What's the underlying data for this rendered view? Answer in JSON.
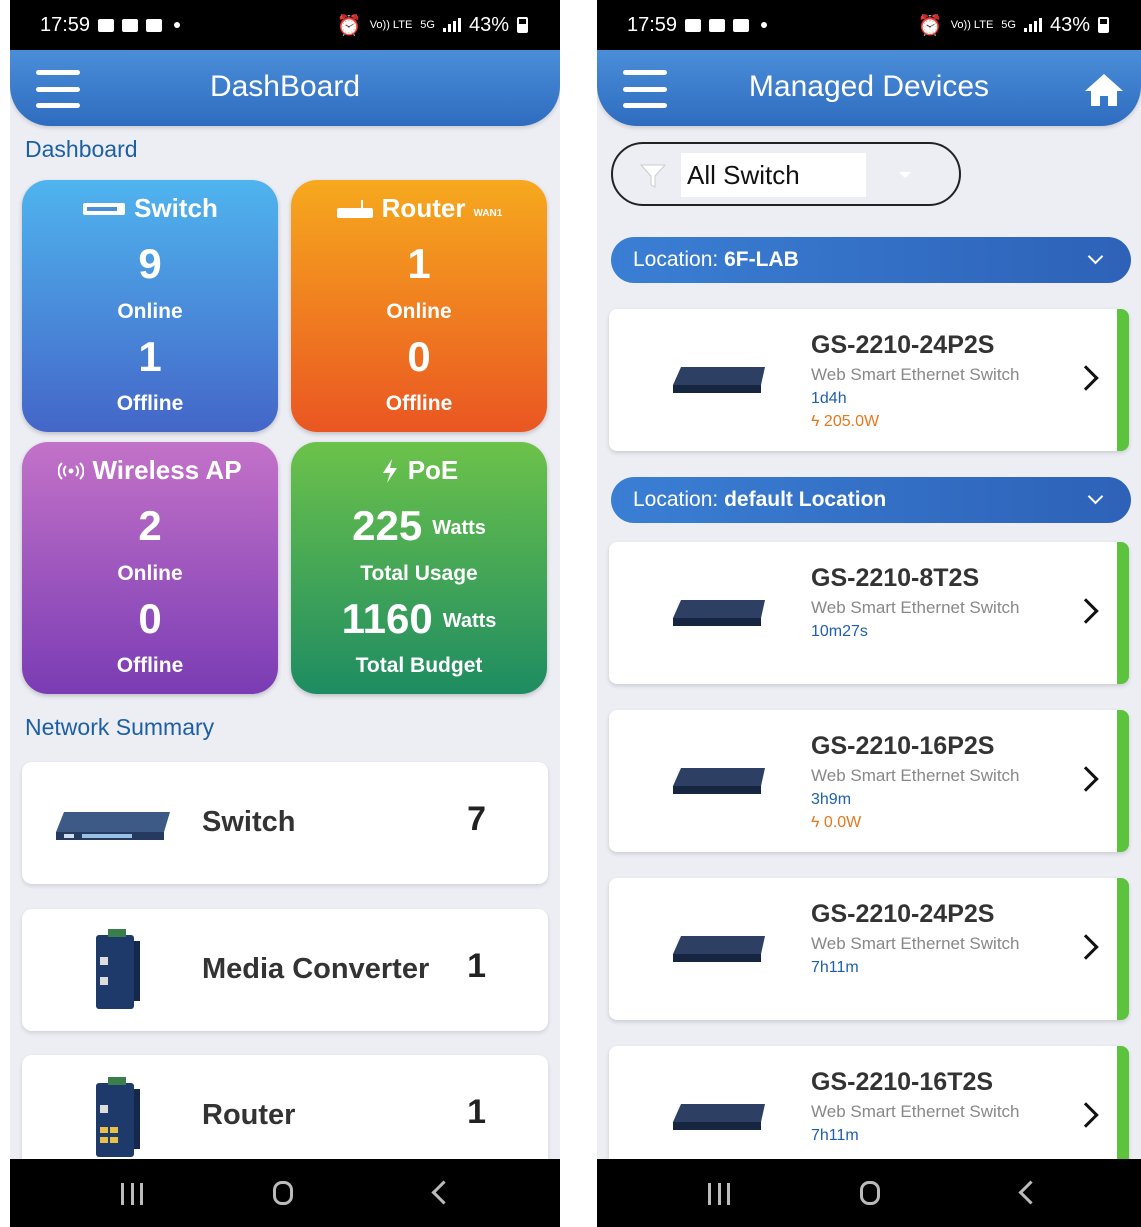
{
  "status_bar": {
    "time": "17:59",
    "battery": "43%",
    "net_volte": "Vo)) LTE",
    "net_5g": "5G"
  },
  "dashboard": {
    "title": "DashBoard",
    "section_label": "Dashboard",
    "tiles": {
      "switch": {
        "title": "Switch",
        "online_count": "9",
        "online_label": "Online",
        "offline_count": "1",
        "offline_label": "Offline",
        "icon": "switch-icon",
        "color": "#4a8ed8"
      },
      "router": {
        "title": "Router",
        "subtitle": "WAN1",
        "online_count": "1",
        "online_label": "Online",
        "offline_count": "0",
        "offline_label": "Offline",
        "icon": "router-icon",
        "color": "#f08a20"
      },
      "wireless_ap": {
        "title": "Wireless AP",
        "online_count": "2",
        "online_label": "Online",
        "offline_count": "0",
        "offline_label": "Offline",
        "icon": "wireless-icon",
        "color": "#a155c0"
      },
      "poe": {
        "title": "PoE",
        "usage": "225",
        "usage_unit": "Watts",
        "usage_label": "Total Usage",
        "budget": "1160",
        "budget_unit": "Watts",
        "budget_label": "Total Budget",
        "icon": "lightning-icon",
        "color": "#3aa85a"
      }
    },
    "network_summary": {
      "label": "Network Summary",
      "items": [
        {
          "name": "Switch",
          "count": "7"
        },
        {
          "name": "Media Converter",
          "count": "1"
        },
        {
          "name": "Router",
          "count": "1"
        }
      ]
    }
  },
  "managed": {
    "title": "Managed Devices",
    "filter": {
      "value": "All Switch"
    },
    "locations": [
      {
        "prefix": "Location: ",
        "name": "6F-LAB"
      },
      {
        "prefix": "Location: ",
        "name": "default Location"
      }
    ],
    "devices": [
      {
        "name": "GS-2210-24P2S",
        "type": "Web Smart Ethernet Switch",
        "uptime": "1d4h",
        "power": "205.0W"
      },
      {
        "name": "GS-2210-8T2S",
        "type": "Web Smart Ethernet Switch",
        "uptime": "10m27s"
      },
      {
        "name": "GS-2210-16P2S",
        "type": "Web Smart Ethernet Switch",
        "uptime": "3h9m",
        "power": "0.0W"
      },
      {
        "name": "GS-2210-24P2S",
        "type": "Web Smart Ethernet Switch",
        "uptime": "7h11m"
      },
      {
        "name": "GS-2210-16T2S",
        "type": "Web Smart Ethernet Switch",
        "uptime": "7h11m"
      }
    ],
    "status_color": "#5cc33c"
  }
}
